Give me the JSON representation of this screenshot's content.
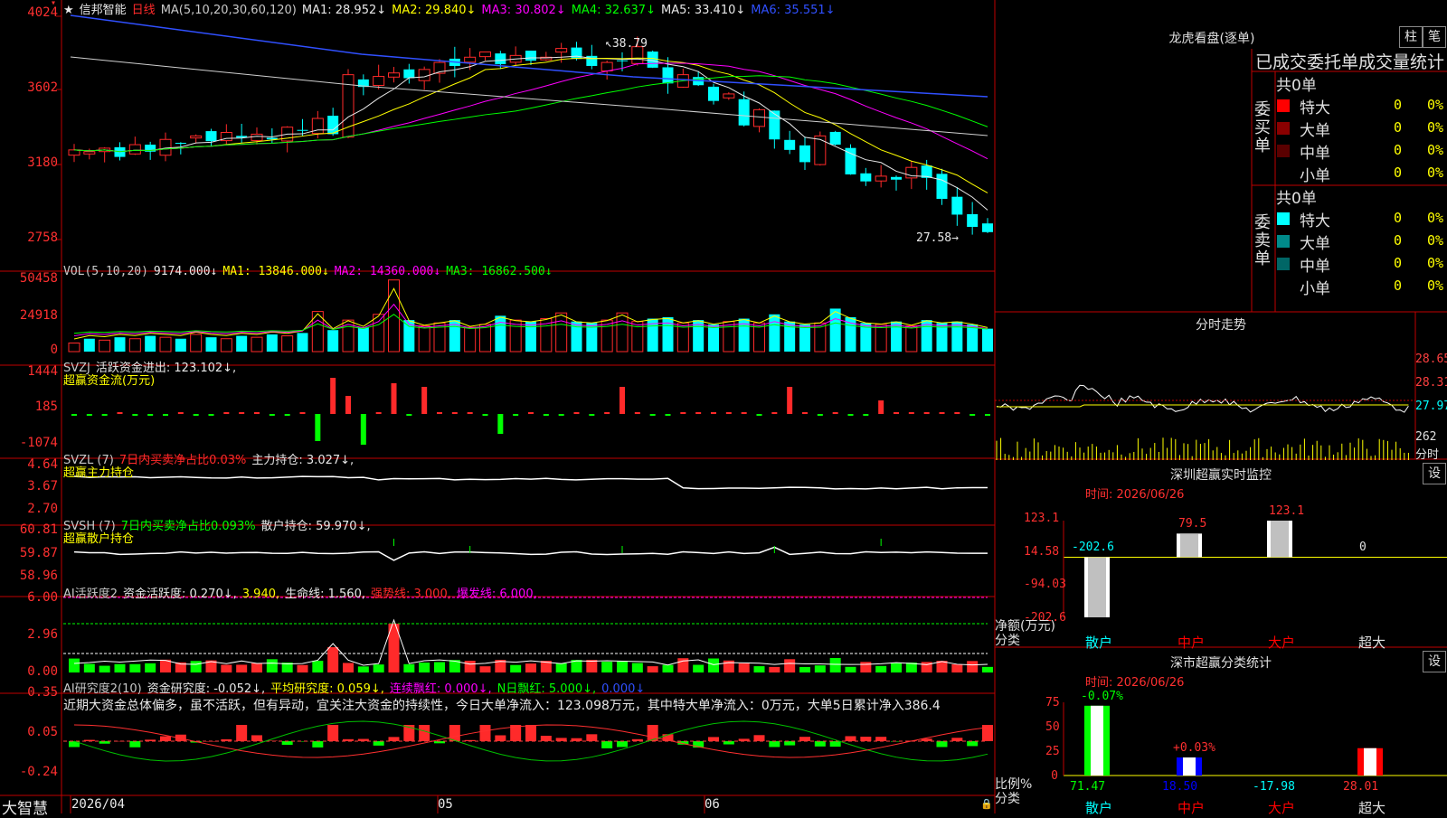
{
  "colors": {
    "up": "#ff2a2a",
    "down": "#00ffff",
    "bg": "#000000",
    "frame": "#c00000",
    "volma1": "#ffff00",
    "volma2": "#ff00ff",
    "volma3": "#00ff00"
  },
  "main": {
    "star": "★",
    "name": "信邦智能",
    "period": "日线",
    "ma_label": "MA(5,10,20,30,60,120)",
    "ma": [
      {
        "label": "MA1: 28.952↓",
        "color": "#e8e8e8"
      },
      {
        "label": "MA2: 29.840↓",
        "color": "#ffff00"
      },
      {
        "label": "MA3: 30.802↓",
        "color": "#ff00ff"
      },
      {
        "label": "MA4: 32.637↓",
        "color": "#00ff00"
      },
      {
        "label": "MA5: 33.410↓",
        "color": "#e8e8e8"
      },
      {
        "label": "MA6: 35.551↓",
        "color": "#3050ff"
      }
    ],
    "axis": [
      "4024",
      "3602",
      "3180",
      "2758"
    ],
    "high_note": "38.79",
    "low_note": "27.58"
  },
  "vol": {
    "title": "VOL(5,10,20)",
    "value": "9174.000↓",
    "ma1": "MA1: 13846.000↓",
    "ma2": "MA2: 14360.000↓",
    "ma3": "MA3: 16862.500↓",
    "axis": [
      "50458",
      "24918",
      "0"
    ]
  },
  "svzj": {
    "title": "SVZJ",
    "l1": "活跃资金进出: 123.102↓,",
    "l2": "超赢资金流(万元)",
    "axis": [
      "1444",
      "185",
      "-1074"
    ]
  },
  "svzl": {
    "title": "SVZL (7)",
    "s1": "7日内买卖净占比0.03%",
    "s2": "主力持仓: 3.027↓,",
    "l2": "超赢主力持仓",
    "axis": [
      "4.64",
      "3.67",
      "2.70"
    ]
  },
  "svsh": {
    "title": "SVSH (7)",
    "s1": "7日内买卖净占比0.093%",
    "s2": "散户持仓: 59.970↓,",
    "l2": "超赢散户持仓",
    "axis": [
      "60.81",
      "59.87",
      "58.96"
    ]
  },
  "ai1": {
    "title": "AI活跃度2",
    "s1": "资金活跃度: 0.270↓,",
    "s2": "3.940,",
    "s3": "生命线: 1.560,",
    "s4": "强势线: 3.000,",
    "s5": "爆发线: 6.000,",
    "axis": [
      "6.00",
      "2.96",
      "0.00"
    ]
  },
  "ai2": {
    "title": "AI研究度2(10)",
    "s1": "资金研究度: -0.052↓,",
    "s2": "平均研究度: 0.059↓,",
    "s3": "连续飘红: 0.000↓,",
    "s4": "N日飘红: 5.000↓,",
    "s5": "0.000↓",
    "text": "近期大资金总体偏多，虽不活跃，但有异动，宜关注大资金的持续性，今日大单净流入：123.098万元，其中特大单净流入：0万元，大单5日累计净入386.4",
    "axis": [
      "0.35",
      "0.05",
      "-0.24"
    ]
  },
  "footer": {
    "brand": "大智慧",
    "date": "2026/04",
    "m5": "05",
    "m6": "06"
  },
  "right": {
    "longhu": {
      "title": "龙虎看盘(逐单)",
      "btn1": "柱",
      "btn2": "笔",
      "subtitle": "已成交委托单成交量统计",
      "buy": {
        "side": "委买单",
        "total": "共0单",
        "rows": [
          {
            "label": "特大",
            "n": "0",
            "p": "0%",
            "color": "#ff0000"
          },
          {
            "label": "大单",
            "n": "0",
            "p": "0%",
            "color": "#8b0000"
          },
          {
            "label": "中单",
            "n": "0",
            "p": "0%",
            "color": "#5a0000"
          },
          {
            "label": "小单",
            "n": "0",
            "p": "0%",
            "color": "#000000"
          }
        ]
      },
      "sell": {
        "side": "委卖单",
        "total": "共0单",
        "rows": [
          {
            "label": "特大",
            "n": "0",
            "p": "0%",
            "color": "#00ffff"
          },
          {
            "label": "大单",
            "n": "0",
            "p": "0%",
            "color": "#008b8b"
          },
          {
            "label": "中单",
            "n": "0",
            "p": "0%",
            "color": "#006666"
          },
          {
            "label": "小单",
            "n": "0",
            "p": "0%",
            "color": "#000000"
          }
        ]
      }
    },
    "intraday": {
      "title": "分时走势",
      "axis": [
        "28.65",
        "28.31",
        "27.97"
      ],
      "vol_label": "262",
      "unit": "分时"
    },
    "monitor": {
      "title": "深圳超赢实时监控",
      "btn": "设",
      "time": "时间: 2026/06/26",
      "axis": [
        "123.1",
        "14.58",
        "-94.03",
        "-202.6"
      ],
      "ylabel": "净额(万元)",
      "xlabel": "分类"
    },
    "stat": {
      "title": "深市超赢分类统计",
      "btn": "设",
      "time": "时间: 2026/06/26",
      "axis": [
        "75",
        "50",
        "25",
        "0"
      ],
      "ylabel": "比例%",
      "xlabel": "分类"
    }
  },
  "chart_data": [
    {
      "type": "bar",
      "title": "深圳超赢实时监控",
      "categories": [
        "散户",
        "中户",
        "大户",
        "超大"
      ],
      "values": [
        -202.6,
        79.5,
        123.1,
        0
      ],
      "value_labels": [
        "-202.6",
        "79.5",
        "123.1",
        "0"
      ],
      "ylim": [
        -202.6,
        123.1
      ]
    },
    {
      "type": "bar",
      "title": "深市超赢分类统计",
      "categories": [
        "散户",
        "中户",
        "大户",
        "超大"
      ],
      "values": [
        71.47,
        18.5,
        -17.98,
        28.01
      ],
      "value_labels": [
        "71.47",
        "18.50",
        "-17.98",
        "28.01"
      ],
      "top_labels": [
        "-0.07%",
        "+0.03%",
        "",
        ""
      ],
      "ylim": [
        0,
        75
      ]
    }
  ]
}
